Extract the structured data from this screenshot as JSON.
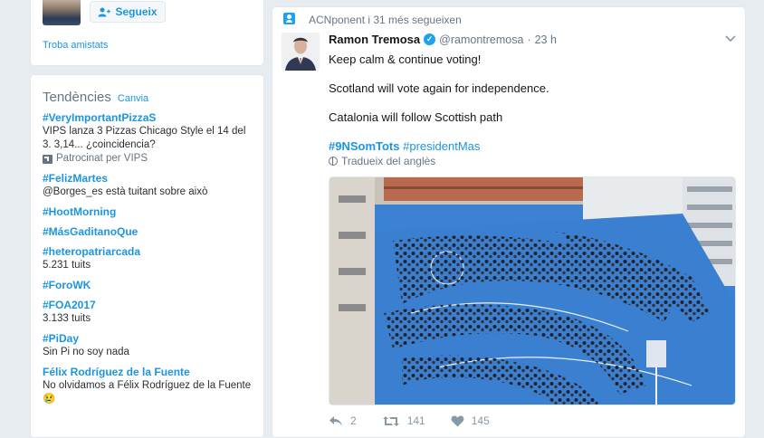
{
  "who_to_follow": {
    "follow_label": "Segueix",
    "find_friends": "Troba amistats"
  },
  "trends": {
    "title": "Tendències",
    "change": "Canvia",
    "items": [
      {
        "name": "#VeryImportantPizzaS",
        "desc": "VIPS lanza 3 Pizzas Chicago Style el 14 del 3. 3,14... ¿coincidencia?",
        "promoted": "Patrocinat per VIPS"
      },
      {
        "name": "#FelizMartes",
        "desc": "@Borges_es està tuitant sobre això"
      },
      {
        "name": "#HootMorning"
      },
      {
        "name": "#MásGaditanoQue"
      },
      {
        "name": "#heteropatriarcada",
        "desc": "5.231 tuits"
      },
      {
        "name": "#ForoWK"
      },
      {
        "name": "#FOA2017",
        "desc": "3.133 tuits"
      },
      {
        "name": "#PiDay",
        "desc": "Sin Pi no soy nada"
      },
      {
        "name": "Félix Rodríguez de la Fuente",
        "desc": "No olvidamos a Félix Rodríguez de la Fuente 😢"
      }
    ]
  },
  "tweet": {
    "context": "ACNponent i 31 més segueixen",
    "fullname": "Ramon Tremosa",
    "screenname": "@ramontremosa",
    "dot": "·",
    "time": "23 h",
    "line1": "Keep calm & continue voting!",
    "line2": "Scotland will vote again for independence.",
    "line3": "Catalonia will follow Scottish path",
    "hashtag1": "#9NSomTots",
    "hashtag2": "#presidentMas",
    "translate": "Tradueix del anglès",
    "replies": "2",
    "retweets": "141",
    "likes": "145"
  },
  "colors": {
    "link": "#1b95e0",
    "background": "#e6ecf0",
    "court_blue": "#3a7fd0"
  },
  "icons": [
    "add-person-icon",
    "promoted-icon",
    "person-icon",
    "verified-icon",
    "chevron-down-icon",
    "globe-icon",
    "reply-icon",
    "retweet-icon",
    "like-icon"
  ]
}
